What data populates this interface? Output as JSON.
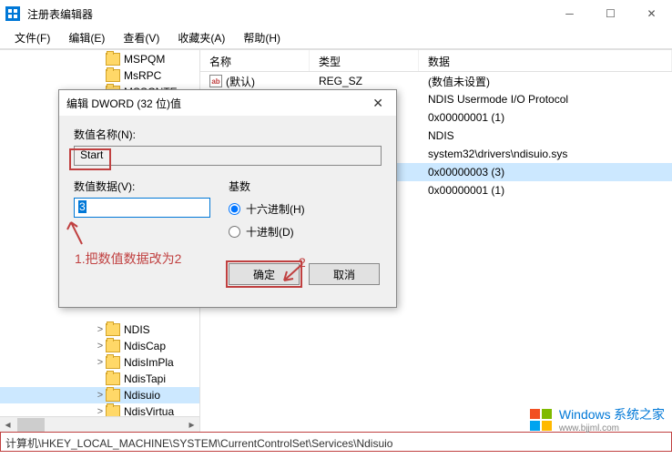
{
  "window": {
    "title": "注册表编辑器"
  },
  "menu": {
    "file": "文件(F)",
    "edit": "编辑(E)",
    "view": "查看(V)",
    "favorites": "收藏夹(A)",
    "help": "帮助(H)"
  },
  "tree": {
    "items": [
      {
        "label": "MSPQM",
        "indent": 104
      },
      {
        "label": "MsRPC",
        "indent": 104
      },
      {
        "label": "MSSCNTE",
        "indent": 104
      },
      {
        "label": "NDIS",
        "indent": 104,
        "exp": ">"
      },
      {
        "label": "NdisCap",
        "indent": 104,
        "exp": ">"
      },
      {
        "label": "NdisImPla",
        "indent": 104,
        "exp": ">"
      },
      {
        "label": "NdisTapi",
        "indent": 104
      },
      {
        "label": "Ndisuio",
        "indent": 104,
        "exp": ">",
        "selected": true
      },
      {
        "label": "NdisVirtua",
        "indent": 104,
        "exp": ">"
      }
    ]
  },
  "list": {
    "columns": {
      "name": "名称",
      "type": "类型",
      "data": "数据"
    },
    "rows": [
      {
        "name": "(默认)",
        "type": "REG_SZ",
        "data": "(数值未设置)"
      },
      {
        "name": "",
        "type": "",
        "data": "NDIS Usermode I/O Protocol"
      },
      {
        "name": "",
        "type": "",
        "data": "0x00000001 (1)"
      },
      {
        "name": "",
        "type": "",
        "data": "NDIS"
      },
      {
        "name": "",
        "type": "",
        "data": "system32\\drivers\\ndisuio.sys"
      },
      {
        "name": "",
        "type": "",
        "data": "0x00000003 (3)",
        "selected": true
      },
      {
        "name": "",
        "type": "",
        "data": "0x00000001 (1)"
      }
    ]
  },
  "dialog": {
    "title": "编辑 DWORD (32 位)值",
    "name_label": "数值名称(N):",
    "name_value": "Start",
    "data_label": "数值数据(V):",
    "data_value": "3",
    "base_label": "基数",
    "radio_hex": "十六进制(H)",
    "radio_dec": "十进制(D)",
    "ok": "确定",
    "cancel": "取消"
  },
  "annotations": {
    "note1": "1.把数值数据改为2",
    "note2": "2"
  },
  "statusbar": {
    "path": "计算机\\HKEY_LOCAL_MACHINE\\SYSTEM\\CurrentControlSet\\Services\\Ndisuio"
  },
  "watermark": {
    "brand": "Windows",
    "suffix": "系统之家",
    "url": "www.bjjml.com"
  }
}
